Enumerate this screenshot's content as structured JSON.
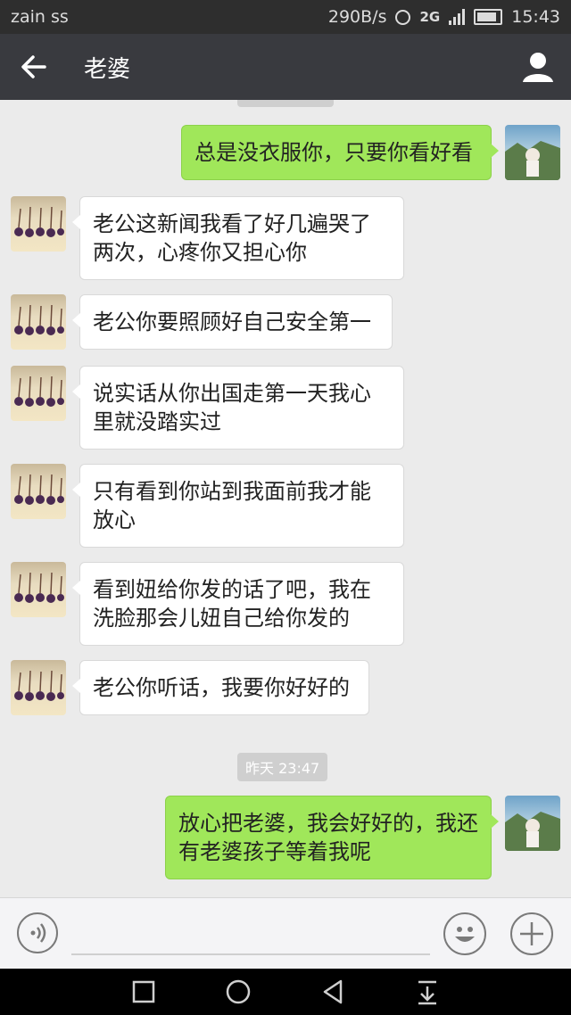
{
  "status_bar": {
    "carrier": "zain ss",
    "speed": "290B/s",
    "network": "2G",
    "network_sub": "2G",
    "time": "15:43"
  },
  "header": {
    "title": "老婆",
    "back_icon": "back-arrow-icon",
    "profile_icon": "person-icon"
  },
  "messages": [
    {
      "side": "out",
      "text": "总是没衣服你，只要你看好看"
    },
    {
      "side": "in",
      "text": "老公这新闻我看了好几遍哭了两次，心疼你又担心你"
    },
    {
      "side": "in",
      "text": "老公你要照顾好自己安全第一"
    },
    {
      "side": "in",
      "text": "说实话从你出国走第一天我心里就没踏实过"
    },
    {
      "side": "in",
      "text": "只有看到你站到我面前我才能放心"
    },
    {
      "side": "in",
      "text": "看到妞给你发的话了吧，我在洗脸那会儿妞自己给你发的"
    },
    {
      "side": "in",
      "text": "老公你听话，我要你好好的"
    },
    {
      "side": "out",
      "text": "放心把老婆，我会好好的，我还有老婆孩子等着我呢"
    }
  ],
  "timestamp": "昨天 23:47",
  "input_bar": {
    "voice_icon": "voice-icon",
    "emoji_icon": "emoji-icon",
    "plus_icon": "plus-icon"
  },
  "nav_bar": {
    "icons": [
      "square-icon",
      "circle-icon",
      "back-triangle-icon",
      "notification-down-icon"
    ]
  },
  "colors": {
    "title_bar": "#393a3f",
    "chat_bg": "#ebebeb",
    "outgoing_bubble": "#a0e75a",
    "incoming_bubble": "#ffffff"
  }
}
